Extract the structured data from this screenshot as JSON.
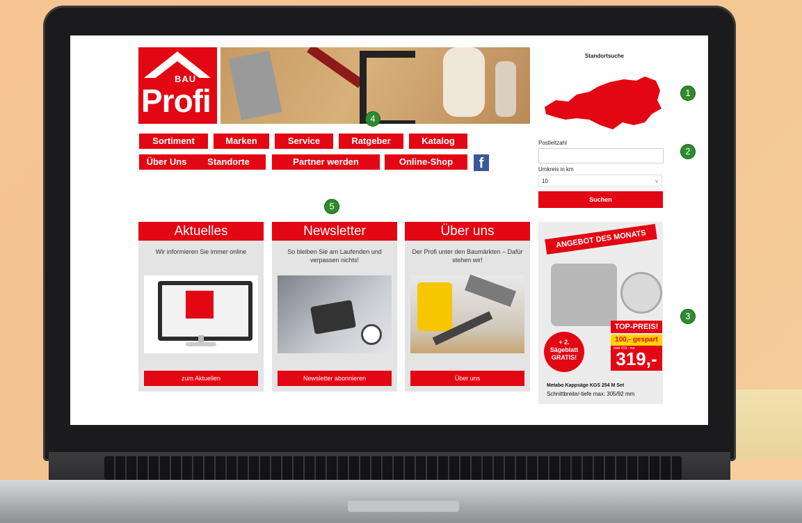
{
  "site": {
    "logo_top": "BAU",
    "logo_bottom": "Profi"
  },
  "nav": {
    "row1": [
      "Sortiment",
      "Marken",
      "Service",
      "Ratgeber",
      "Katalog"
    ],
    "row2": [
      "Über Uns",
      "Standorte",
      "Partner werden",
      "Online-Shop"
    ],
    "facebook_glyph": "f"
  },
  "store_finder": {
    "title": "Standortsuche",
    "postcode_label": "Postleitzahl",
    "postcode_value": "",
    "radius_label": "Umkreis in km",
    "radius_value": "10",
    "search_label": "Suchen"
  },
  "cards": [
    {
      "title": "Aktuelles",
      "text": "Wir informieren Sie immer online",
      "cta": "zum Aktuellen"
    },
    {
      "title": "Newsletter",
      "text": "So bleiben Sie am Laufenden und verpassen nichts!",
      "cta": "Newsletter abonnieren"
    },
    {
      "title": "Über uns",
      "text": "Der Profi unter den Baumärkten – Dafür stehen wir!",
      "cta": "Über uns"
    }
  ],
  "offer": {
    "ribbon": "ANGEBOT DES MONATS",
    "burst": "+ 2. Sägeblatt GRATIS!",
    "badge": "TOP-PREIS!",
    "saving": "100,- gespart",
    "old_price": "statt 419,- nur",
    "price": "319,-",
    "product": "Metabo Kappsäge KGS 254 M Set",
    "spec": "Schnittbreite/-tiefe max: 305/92 mm"
  },
  "markers": [
    "1",
    "2",
    "3",
    "4",
    "5"
  ],
  "colors": {
    "brand_red": "#e30613",
    "marker_green": "#2e8b2e",
    "facebook": "#3b5998"
  }
}
